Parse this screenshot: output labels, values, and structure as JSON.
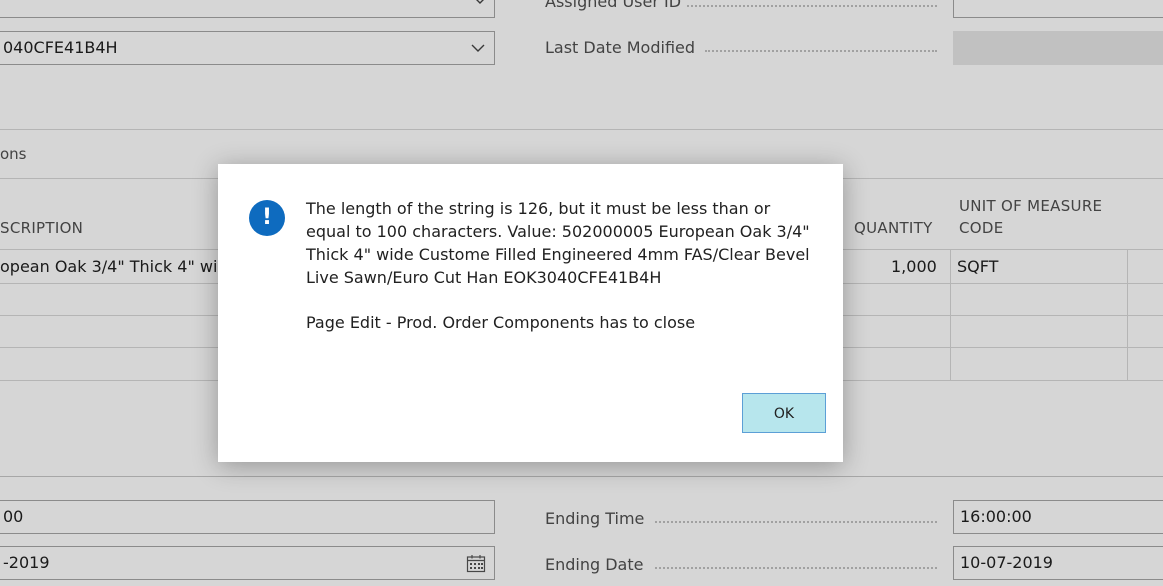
{
  "header_fields": {
    "source_no_value": "040CFE41B4H",
    "assigned_user_label": "Assigned User ID",
    "last_modified_label": "Last Date Modified"
  },
  "section": {
    "tab_label": "ons"
  },
  "table": {
    "columns": {
      "description": "SCRIPTION",
      "quantity": "QUANTITY",
      "uom_line1": "UNIT OF MEASURE",
      "uom_line2": "CODE"
    },
    "rows": [
      {
        "description": "opean Oak 3/4\" Thick 4\" wid",
        "quantity": "1,000",
        "uom": "SQFT"
      }
    ]
  },
  "footer_fields": {
    "starting_time_value": "00",
    "starting_date_value": "-2019",
    "ending_time_label": "Ending Time",
    "ending_time_value": "16:00:00",
    "ending_date_label": "Ending Date",
    "ending_date_value": "10-07-2019"
  },
  "dialog": {
    "message": "The length of the string is 126, but it must be less than or equal to 100 characters. Value: 502000005 European Oak 3/4\" Thick 4\" wide Custome Filled Engineered 4mm FAS/Clear Bevel Live Sawn/Euro Cut Han EOK3040CFE41B4H",
    "detail": "Page Edit - Prod. Order Components has to close",
    "ok_label": "OK",
    "icon": "info-icon"
  },
  "colors": {
    "accent": "#0e6bbf",
    "ok_button_bg": "#b7e6ed",
    "ok_button_border": "#5c9fd6"
  }
}
